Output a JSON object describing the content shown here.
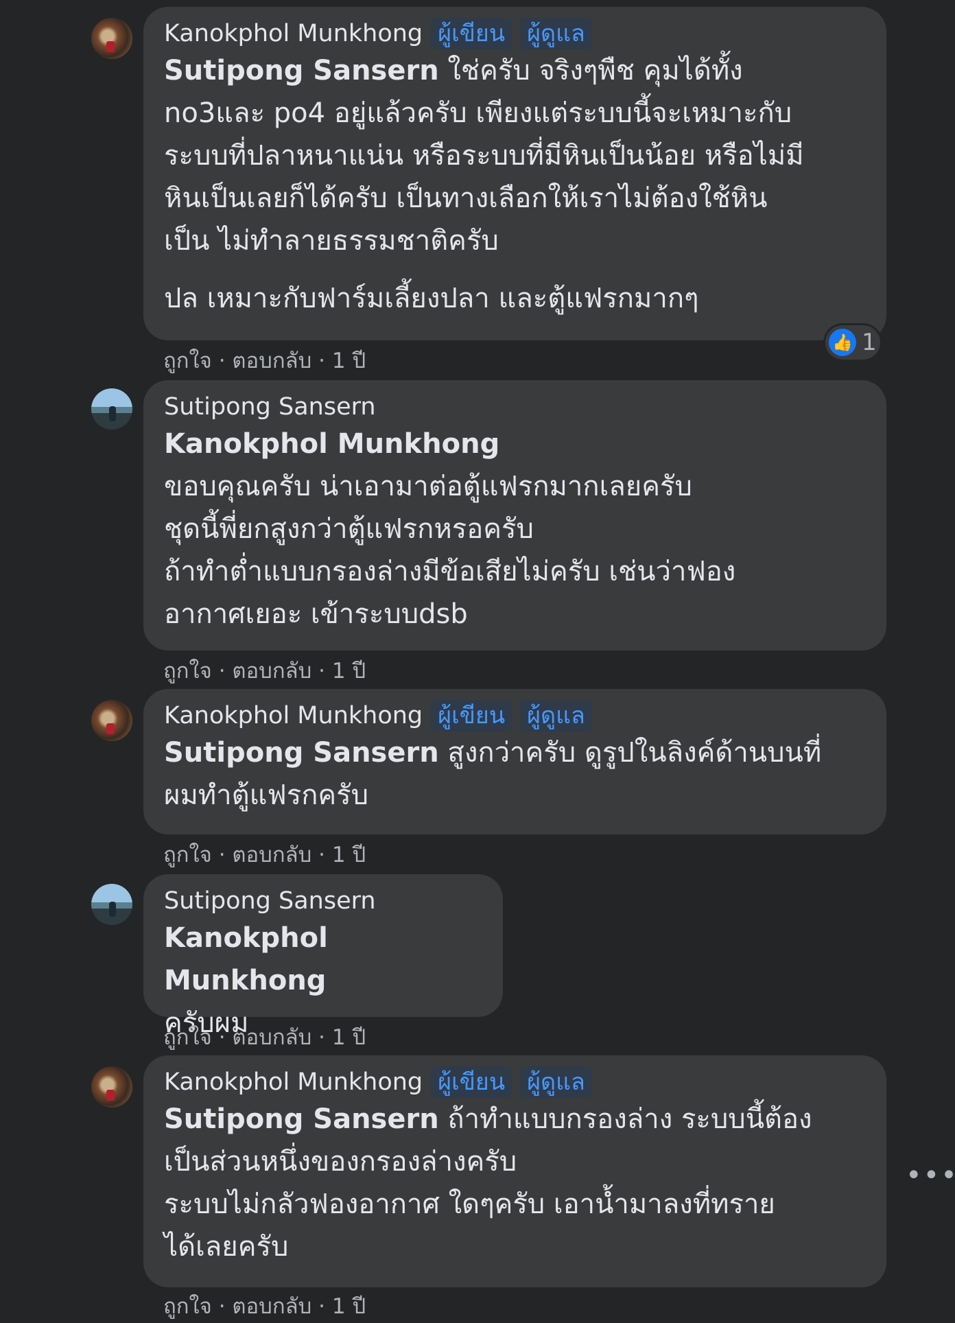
{
  "comments": [
    {
      "author": "Kanokphol Munkhong",
      "badges": [
        "ผู้เขียน",
        "ผู้ดูแล"
      ],
      "mention": "Sutipong Sansern",
      "text_first": " ใช่ครับ จริงๆพืช คุมได้ทั้ง",
      "text_lines": "no3และ po4 อยู่แล้วครับ เพียงแต่ระบบนี้จะเหมาะกับ\nระบบที่ปลาหนาแน่น หรือระบบที่มีหินเป็นน้อย หรือไม่มี\nหินเป็นเลยก็ได้ครับ เป็นทางเลือกให้เราไม่ต้องใช้หิน\nเป็น ไม่ทำลายธรรมชาติครับ",
      "text_ps": "ปล เหมาะกับฟาร์มเลี้ยงปลา และตู้แฟรกมากๆ",
      "reaction_count": "1",
      "like": "ถูกใจ",
      "reply": "ตอบกลับ",
      "time": "1 ปี"
    },
    {
      "author": "Sutipong Sansern",
      "mention": "Kanokphol Munkhong",
      "text": "ขอบคุณครับ น่าเอามาต่อตู้แฟรกมากเลยครับ\nชุดนี้พี่ยกสูงกว่าตู้แฟรกหรอครับ\nถ้าทำต่ำแบบกรองล่างมีข้อเสียไม่ครับ เช่นว่าฟอง\nอากาศเยอะ เข้าระบบdsb",
      "like": "ถูกใจ",
      "reply": "ตอบกลับ",
      "time": "1 ปี"
    },
    {
      "author": "Kanokphol Munkhong",
      "badges": [
        "ผู้เขียน",
        "ผู้ดูแล"
      ],
      "mention": "Sutipong Sansern",
      "text_first": " สูงกว่าครับ ดูรูปในลิงค์ด้านบนที่",
      "text_lines": "ผมทำตู้แฟรกครับ",
      "like": "ถูกใจ",
      "reply": "ตอบกลับ",
      "time": "1 ปี"
    },
    {
      "author": "Sutipong Sansern",
      "mention": "Kanokphol Munkhong",
      "text": "ครับผม",
      "like": "ถูกใจ",
      "reply": "ตอบกลับ",
      "time": "1 ปี"
    },
    {
      "author": "Kanokphol Munkhong",
      "badges": [
        "ผู้เขียน",
        "ผู้ดูแล"
      ],
      "mention": "Sutipong Sansern",
      "text_first": " ถ้าทำแบบกรองล่าง ระบบนี้ต้อง",
      "text_lines": "เป็นส่วนหนึ่งของกรองล่างครับ\nระบบไม่กลัวฟองอากาศ ใดๆครับ เอาน้ำมาลงที่ทราย\nได้เลยครับ",
      "like": "ถูกใจ",
      "reply": "ตอบกลับ",
      "time": "1 ปี"
    }
  ],
  "meta_separator": "·",
  "more_icon": "•••",
  "like_icon": "👍"
}
